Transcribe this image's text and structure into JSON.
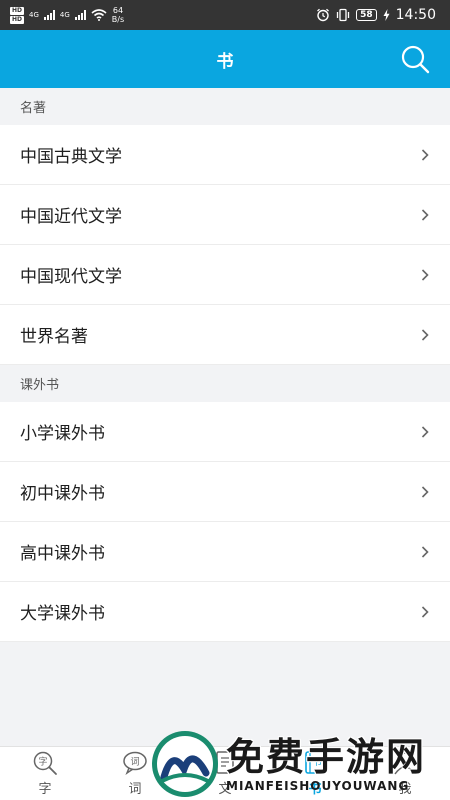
{
  "status_bar": {
    "hd_tags": [
      "HD",
      "HD"
    ],
    "network": [
      "4G",
      "4G"
    ],
    "speed_value": "64",
    "speed_unit": "B/s",
    "battery": "58",
    "time": "14:50"
  },
  "header": {
    "title": "书",
    "search_icon": "search-icon"
  },
  "sections": [
    {
      "title": "名著",
      "items": [
        "中国古典文学",
        "中国近代文学",
        "中国现代文学",
        "世界名著"
      ]
    },
    {
      "title": "课外书",
      "items": [
        "小学课外书",
        "初中课外书",
        "高中课外书",
        "大学课外书"
      ]
    }
  ],
  "bottom_nav": {
    "items": [
      {
        "label": "字",
        "icon": "character-search-icon"
      },
      {
        "label": "词",
        "icon": "word-chat-icon"
      },
      {
        "label": "文",
        "icon": "document-icon"
      },
      {
        "label": "书",
        "icon": "book-icon"
      },
      {
        "label": "我",
        "icon": "profile-icon"
      }
    ],
    "active_index": 3
  },
  "watermark": {
    "title": "免费手游网",
    "subtitle": "MIANFEISHOUYOUWANG"
  },
  "colors": {
    "accent": "#0aa6e0",
    "status_bar": "#343434",
    "background": "#f2f3f5"
  }
}
